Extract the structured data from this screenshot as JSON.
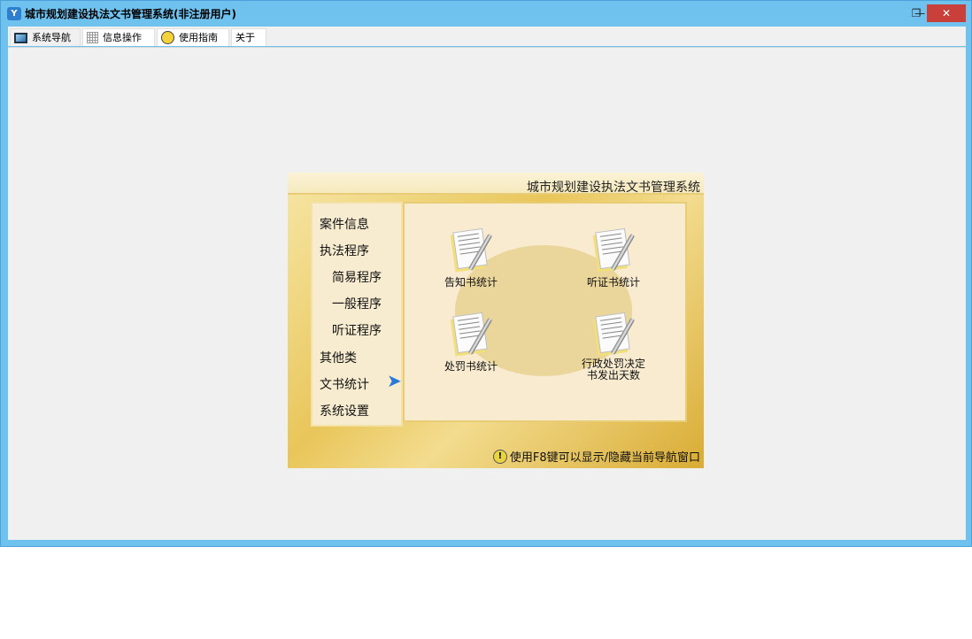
{
  "window": {
    "title": "城市规划建设执法文书管理系统(非注册用户)",
    "minimize": "—",
    "restore": "❐",
    "close": "✕"
  },
  "tabs": [
    {
      "label": "系统导航"
    },
    {
      "label": "信息操作"
    },
    {
      "label": "使用指南"
    },
    {
      "label": "关于"
    }
  ],
  "panel": {
    "title": "城市规划建设执法文书管理系统",
    "menu": [
      "案件信息",
      "执法程序",
      "简易程序",
      "一般程序",
      "听证程序",
      "其他类",
      "文书统计",
      "系统设置"
    ],
    "items": [
      "告知书统计",
      "听证书统计",
      "处罚书统计",
      "行政处罚决定\n书发出天数"
    ],
    "hint": "使用F8键可以显示/隐藏当前导航窗口"
  }
}
